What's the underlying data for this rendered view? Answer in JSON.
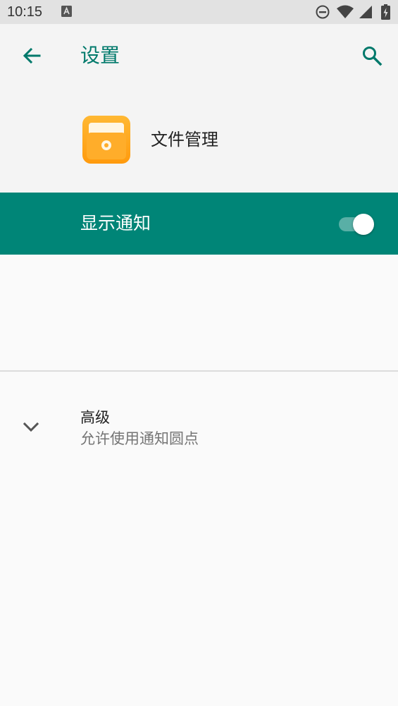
{
  "status_bar": {
    "time": "10:15",
    "icons": [
      "notification-a-icon",
      "do-not-disturb-icon",
      "wifi-icon",
      "cell-signal-icon",
      "battery-charging-icon"
    ]
  },
  "app_bar": {
    "title": "设置",
    "back_icon": "arrow-back-icon",
    "search_icon": "search-icon"
  },
  "app_header": {
    "app_name": "文件管理",
    "icon": "file-manager-app-icon"
  },
  "notification_toggle": {
    "label": "显示通知",
    "enabled": true
  },
  "advanced": {
    "title": "高级",
    "summary": "允许使用通知圆点",
    "icon": "chevron-down-icon"
  },
  "colors": {
    "accent": "#008577",
    "title_text": "#00796b",
    "app_bar_bg": "#f4f4f4",
    "status_bar_bg": "#e2e2e2",
    "app_icon_orange": "#ffa415"
  }
}
